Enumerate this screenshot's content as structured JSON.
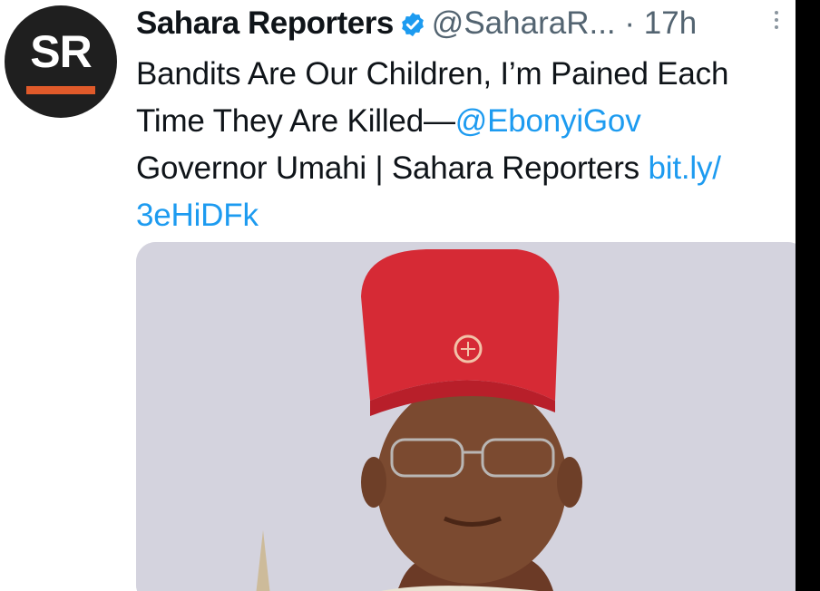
{
  "tweet": {
    "author": {
      "name": "Sahara Reporters",
      "handle": "@SaharaR...",
      "avatar_text": "SR",
      "verified_icon": "verified-badge-icon"
    },
    "separator": "·",
    "time": "17h",
    "more_icon": "more-options-icon",
    "text": {
      "line1": "Bandits Are Our Children, I’m Pained Each",
      "line2_prefix": "Time They Are Killed—",
      "line2_mention": "@EbonyiGov",
      "line3_prefix": "Governor Umahi | Sahara Reporters ",
      "line3_link": "bit.ly/",
      "line4_link": "3eHiDFk"
    },
    "media": {
      "kind": "photo"
    }
  },
  "colors": {
    "link": "#1d9bf0",
    "avatar_bg": "#1f1f1f",
    "avatar_accent": "#e05a2a",
    "hat": "#d62a35",
    "media_bg": "#d4d3de"
  }
}
